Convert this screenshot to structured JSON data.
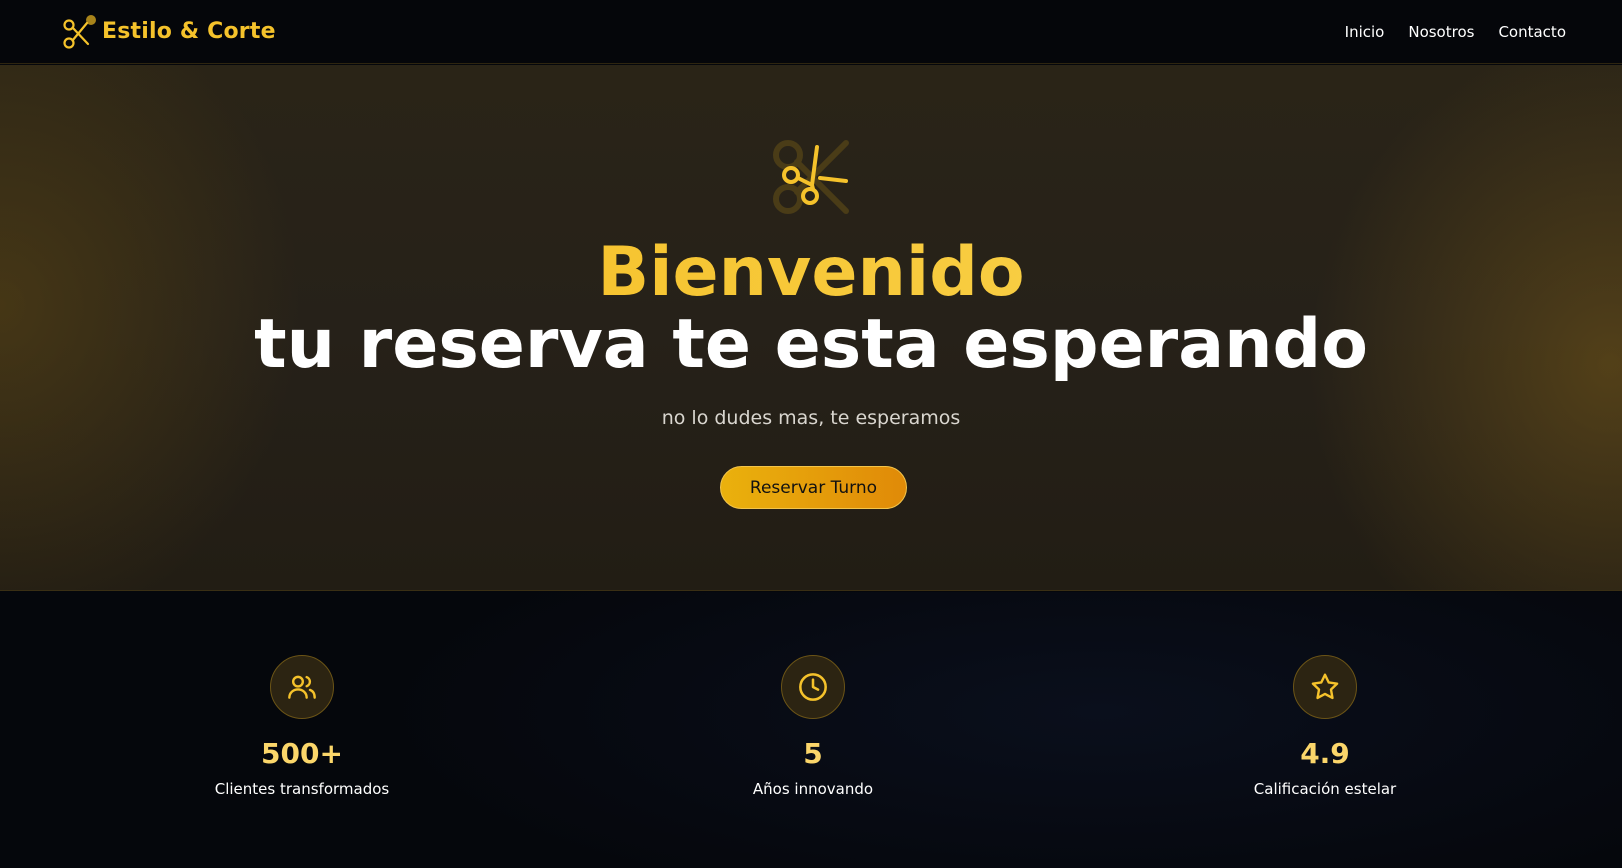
{
  "nav": {
    "brand_name": "Estilo & Corte",
    "brand_icon": "scissors-icon",
    "links": [
      {
        "label": "Inicio"
      },
      {
        "label": "Nosotros"
      },
      {
        "label": "Contacto"
      }
    ]
  },
  "hero": {
    "icon": "scissors-icon",
    "title_line1": "Bienvenido",
    "title_line2": "tu reserva te esta esperando",
    "subtitle": "no lo dudes mas, te esperamos",
    "cta_label": "Reservar Turno"
  },
  "stats": [
    {
      "icon": "users-icon",
      "value": "500+",
      "label": "Clientes transformados"
    },
    {
      "icon": "clock-icon",
      "value": "5",
      "label": "Años innovando"
    },
    {
      "icon": "star-icon",
      "value": "4.9",
      "label": "Calificación estelar"
    }
  ],
  "colors": {
    "accent": "#f5c22b",
    "cta_gradient_start": "#eab10d",
    "cta_gradient_end": "#e08a08",
    "background": "#05070c"
  }
}
